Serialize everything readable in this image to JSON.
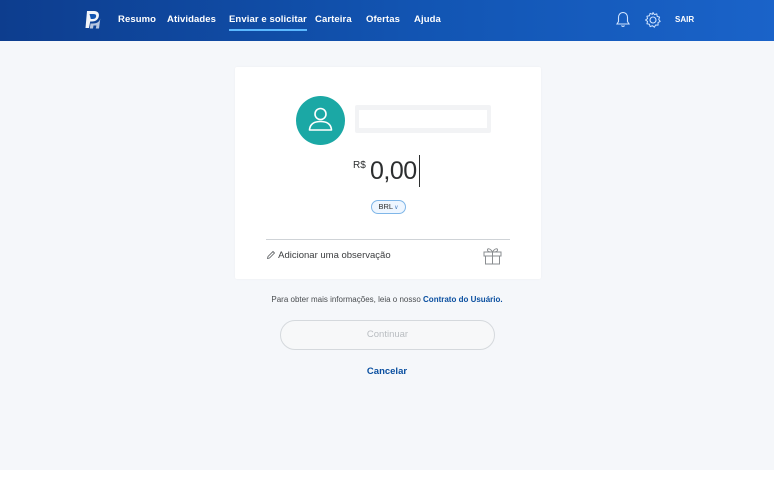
{
  "nav": {
    "items": [
      {
        "label": "Resumo"
      },
      {
        "label": "Atividades"
      },
      {
        "label": "Enviar e solicitar",
        "active": true
      },
      {
        "label": "Carteira"
      },
      {
        "label": "Ofertas"
      },
      {
        "label": "Ajuda"
      }
    ],
    "logout_label": "SAIR",
    "icons": [
      "paypal-logo",
      "bell-icon",
      "gear-icon"
    ],
    "colors": {
      "nav_bg": "#1255b3",
      "active_underline": "#5bb8ff"
    }
  },
  "payment": {
    "currency_symbol": "R$",
    "amount": "0,00",
    "currency_code": "BRL",
    "note_label": "Adicionar uma observação"
  },
  "legal": {
    "text": "Para obter mais informações, leia o nosso",
    "link_text": "Contrato do Usuário",
    "suffix": "."
  },
  "actions": {
    "continue_label": "Continuar",
    "cancel_label": "Cancelar"
  },
  "colors": {
    "avatar": "#1ba8a5",
    "link": "#0a4fa0",
    "page_bg": "#f5f7fa"
  }
}
